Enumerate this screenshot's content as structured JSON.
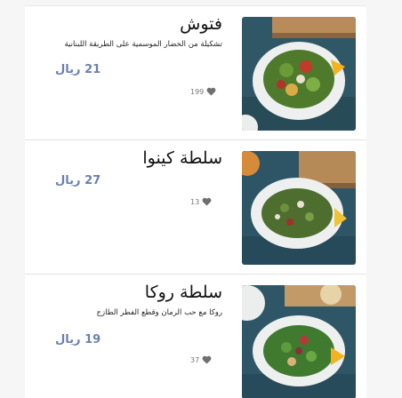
{
  "menu": {
    "items": [
      {
        "title": "فتوش",
        "description": "تشكيلة من الخضار الموسمية على الطريقة اللبنانية",
        "price": "21 ريال",
        "likes": "199",
        "image": "fattoush-salad"
      },
      {
        "title": "سلطة كينوا",
        "description": "",
        "price": "27 ريال",
        "likes": "13",
        "image": "quinoa-salad"
      },
      {
        "title": "سلطة روكا",
        "description": "روكا مع حب الرمان وقطع الفطر الطازج",
        "price": "19 ريال",
        "likes": "37",
        "image": "rocca-salad"
      }
    ]
  },
  "icons": {
    "like": "heart-icon"
  },
  "colors": {
    "price": "#6b7fb0",
    "background": "#f6f6f7",
    "card": "#ffffff"
  }
}
